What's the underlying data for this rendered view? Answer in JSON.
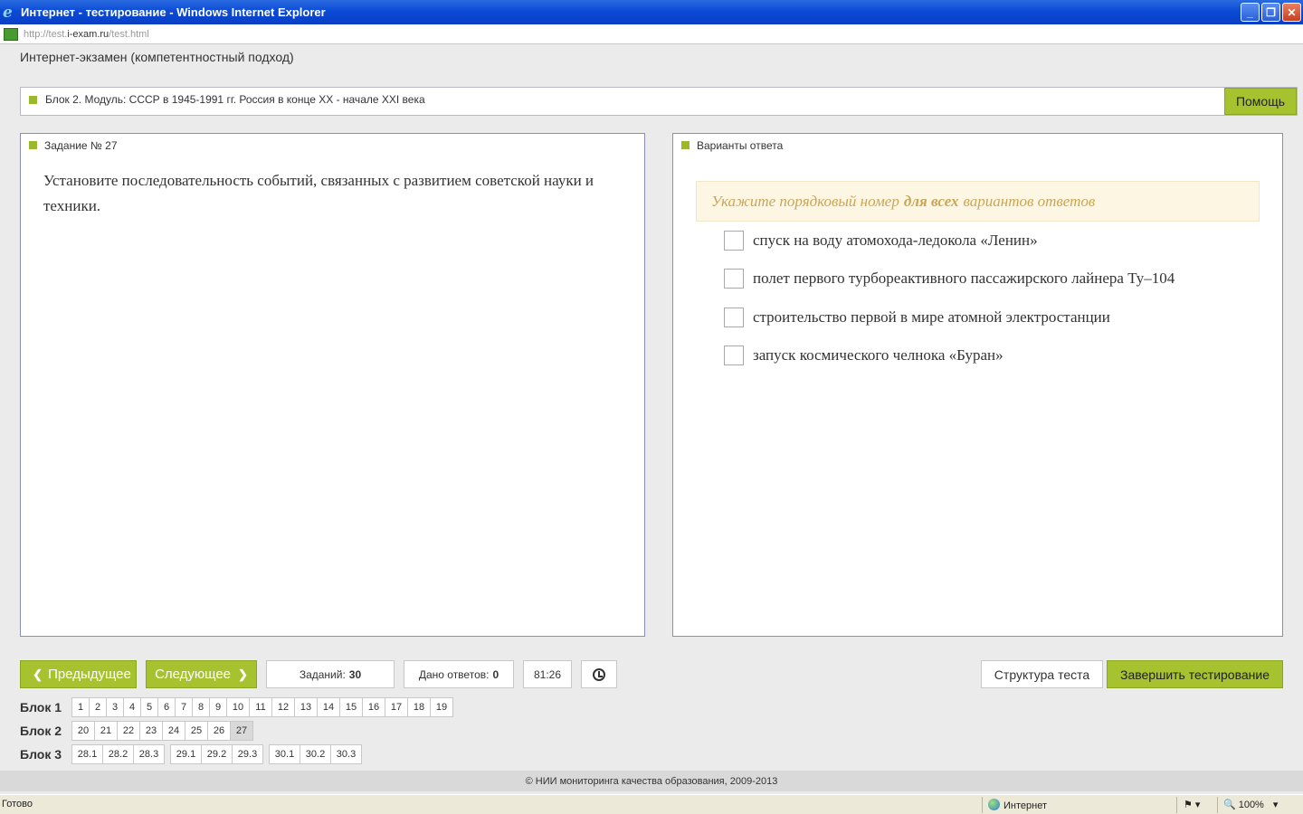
{
  "window": {
    "title": "Интернет - тестирование - Windows Internet Explorer",
    "minimize": "_",
    "restore": "❐",
    "close": "✕"
  },
  "address": {
    "prefix": "http://test.",
    "host": "i-exam.ru",
    "path": "/test.html"
  },
  "header": {
    "title": "Интернет-экзамен (компетентностный подход)"
  },
  "module": {
    "label": "Блок 2. Модуль: СССР в 1945-1991 гг. Россия в конце XX - начале XXI века",
    "help": "Помощь"
  },
  "task": {
    "label": "Задание № 27",
    "text": "Установите последовательность событий, связанных с развитием советской науки и техники."
  },
  "answers": {
    "label": "Варианты ответа",
    "hint_before": "Укажите порядковый номер",
    "hint_bold": "для всех",
    "hint_after": "вариантов ответов",
    "options": [
      "спуск на воду атомохода-ледокола «Ленин»",
      "полет первого турбореактивного пассажирского лайнера Ту–104",
      "строительство первой в мире атомной электростанции",
      "запуск космического челнока «Буран»"
    ]
  },
  "nav": {
    "prev": "Предыдущее",
    "next": "Следующее",
    "tasks_label": "Заданий:",
    "tasks_count": "30",
    "answers_label": "Дано ответов:",
    "answers_count": "0",
    "timer": "81:26",
    "structure": "Структура теста",
    "finish": "Завершить тестирование"
  },
  "blocks": [
    {
      "label": "Блок 1",
      "groups": [
        [
          "1",
          "2",
          "3",
          "4",
          "5",
          "6",
          "7",
          "8",
          "9",
          "10",
          "11",
          "12",
          "13",
          "14",
          "15",
          "16",
          "17",
          "18",
          "19"
        ]
      ]
    },
    {
      "label": "Блок 2",
      "groups": [
        [
          "20",
          "21",
          "22",
          "23",
          "24",
          "25",
          "26",
          "27"
        ]
      ],
      "active": "27"
    },
    {
      "label": "Блок 3",
      "groups": [
        [
          "28.1",
          "28.2",
          "28.3"
        ],
        [
          "29.1",
          "29.2",
          "29.3"
        ],
        [
          "30.1",
          "30.2",
          "30.3"
        ]
      ]
    }
  ],
  "footer": {
    "text": "© НИИ мониторинга качества образования, 2009-2013"
  },
  "status": {
    "left": "Готово",
    "zone": "Интернет",
    "zoom": "100%"
  }
}
